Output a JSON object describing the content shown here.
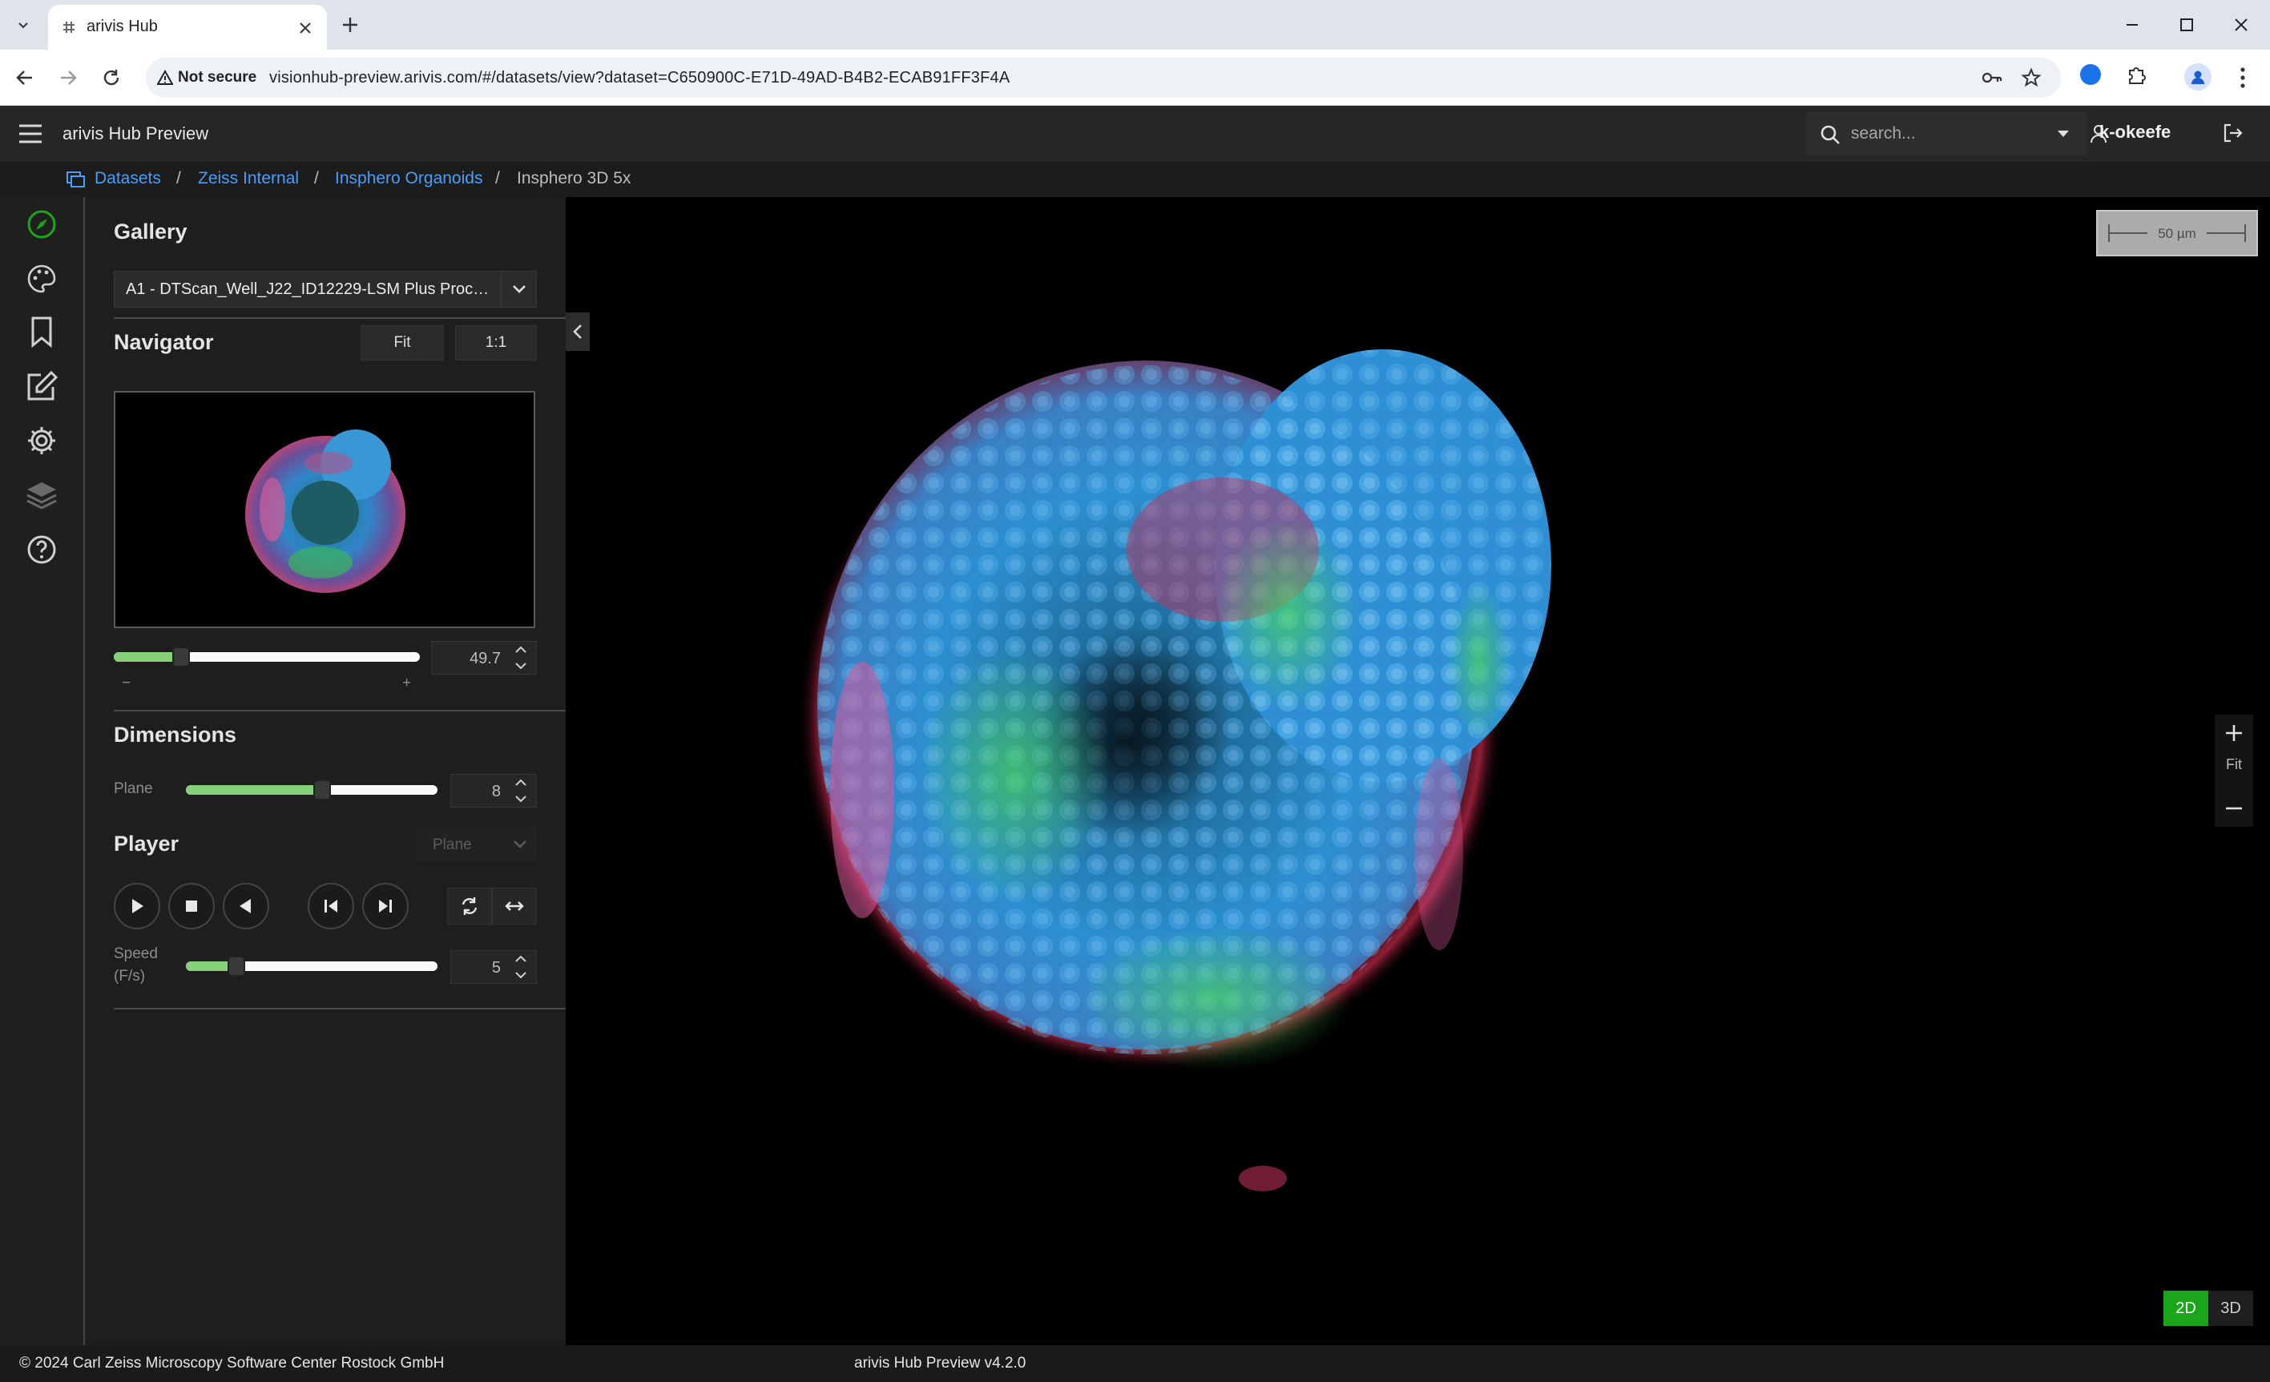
{
  "browser": {
    "tab_title": "arivis Hub",
    "security_label": "Not secure",
    "url": "visionhub-preview.arivis.com/#/datasets/view?dataset=C650900C-E71D-49AD-B4B2-ECAB91FF3F4A"
  },
  "app": {
    "title": "arivis Hub Preview",
    "search_placeholder": "search...",
    "user": "k-okeefe"
  },
  "breadcrumb": {
    "items": [
      "Datasets",
      "Zeiss Internal",
      "Insphero Organoids"
    ],
    "current": "Insphero 3D 5x",
    "separator": "/"
  },
  "panel": {
    "gallery": {
      "title": "Gallery",
      "selected": "A1 - DTScan_Well_J22_ID12229-LSM Plus Processing"
    },
    "navigator": {
      "title": "Navigator",
      "fit_label": "Fit",
      "one_to_one_label": "1:1",
      "zoom_value": "49.7",
      "zoom_fraction": 0.22,
      "minus_label": "−",
      "plus_label": "+"
    },
    "dimensions": {
      "title": "Dimensions",
      "plane_label": "Plane",
      "plane_value": "8",
      "plane_fraction": 0.54
    },
    "player": {
      "title": "Player",
      "mode_select": "Plane",
      "speed_label_line1": "Speed",
      "speed_label_line2": "(F/s)",
      "speed_value": "5",
      "speed_fraction": 0.2
    }
  },
  "viewer": {
    "scale_label": "50 µm",
    "zoom_fit_label": "Fit",
    "mode_2d": "2D",
    "mode_3d": "3D",
    "active_mode": "2D"
  },
  "footer": {
    "copyright": "© 2024 Carl Zeiss Microscopy Software Center Rostock GmbH",
    "version": "arivis Hub Preview v4.2.0"
  },
  "colors": {
    "accent_green": "#1aa51a",
    "link_blue": "#4a9ef5",
    "slider_fill": "#86d07a",
    "nucleus_blue": "#2f8fd6",
    "marker_green": "#3ec65a",
    "marker_red": "#e2506e"
  },
  "icons": [
    "hamburger-menu-icon",
    "search-icon",
    "user-icon",
    "logout-icon",
    "compass-icon",
    "palette-icon",
    "bookmark-icon",
    "edit-icon",
    "gear-icon",
    "layers-icon",
    "help-icon"
  ]
}
